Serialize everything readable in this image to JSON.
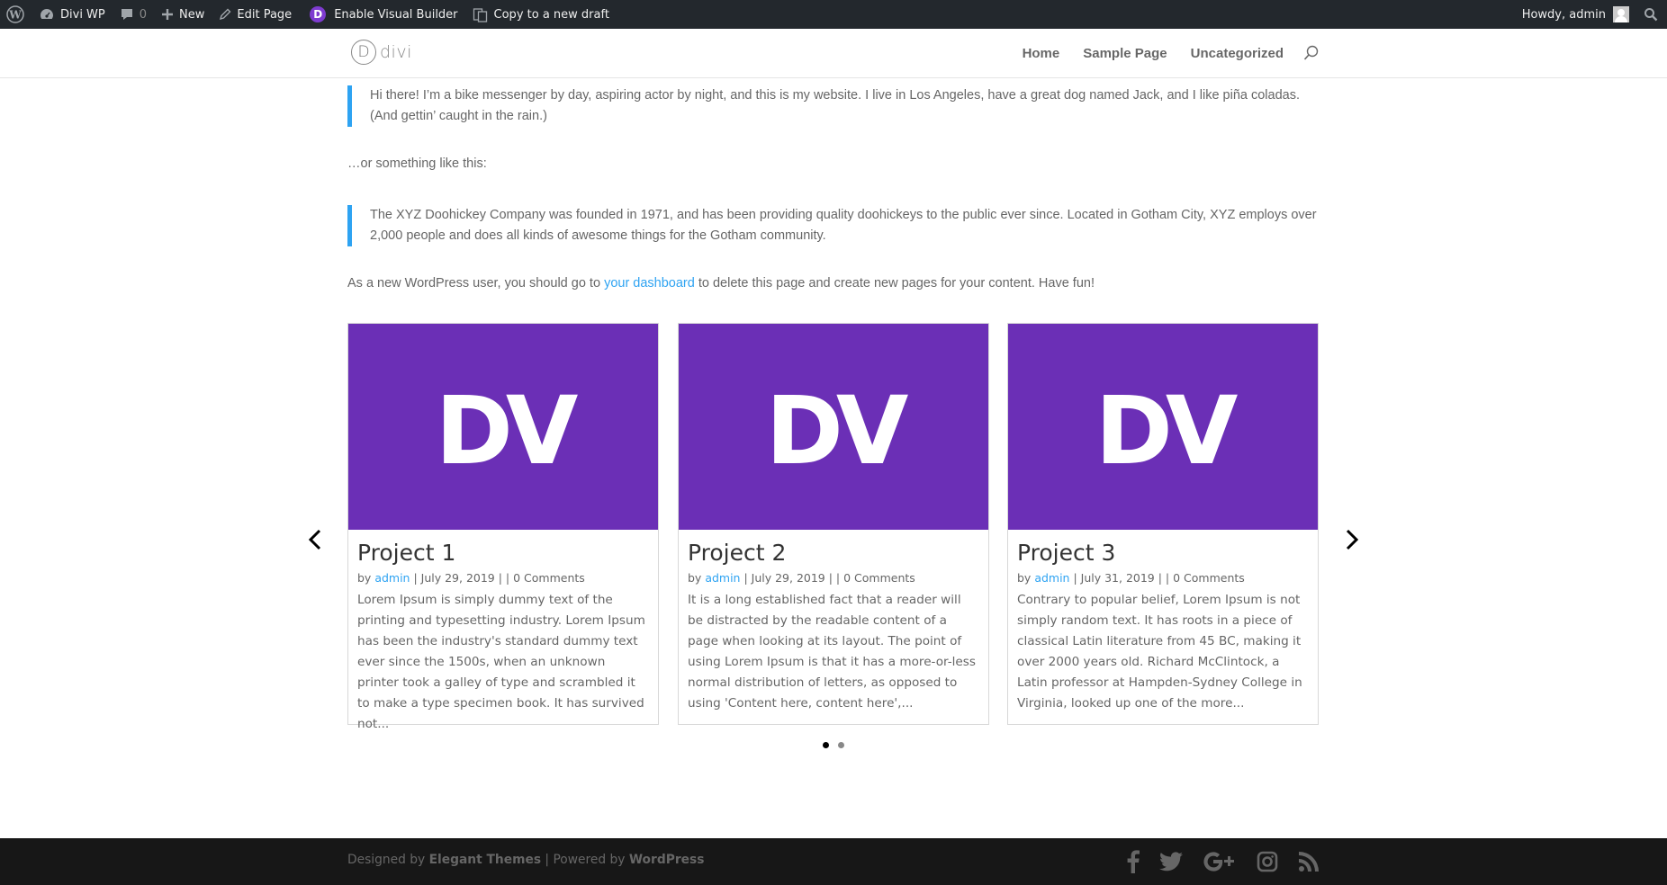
{
  "admin_bar": {
    "site_name": "Divi WP",
    "comments_count": "0",
    "new_label": "New",
    "edit_label": "Edit Page",
    "visual_builder_label": "Enable Visual Builder",
    "divi_icon_letter": "D",
    "copy_label": "Copy to a new draft",
    "howdy": "Howdy, admin"
  },
  "header": {
    "logo_letter": "D",
    "logo_text": "divi",
    "nav": [
      "Home",
      "Sample Page",
      "Uncategorized"
    ]
  },
  "content": {
    "quote1": "Hi there! I’m a bike messenger by day, aspiring actor by night, and this is my website. I live in Los Angeles, have a great dog named Jack, and I like piña coladas. (And gettin’ caught in the rain.)",
    "middle": "…or something like this:",
    "quote2": "The XYZ Doohickey Company was founded in 1971, and has been providing quality doohickeys to the public ever since. Located in Gotham City, XYZ employs over 2,000 people and does all kinds of awesome things for the Gotham community.",
    "final_before": "As a new WordPress user, you should go to ",
    "final_link": "your dashboard",
    "final_after": " to delete this page and create new pages for your content. Have fun!"
  },
  "carousel": {
    "image_text": "DV",
    "image_color": "#6b2fb6",
    "accent_color": "#2ea3f2",
    "cards": [
      {
        "title": "Project 1",
        "by": "by ",
        "author": "admin",
        "date": " | July 29, 2019 | | 0 Comments",
        "excerpt": "Lorem Ipsum is simply dummy text of the printing and typesetting industry. Lorem Ipsum has been the industry's standard dummy text ever since the 1500s, when an unknown printer took a galley of type and scrambled it to make a type specimen book. It has survived not..."
      },
      {
        "title": "Project 2",
        "by": "by ",
        "author": "admin",
        "date": " | July 29, 2019 | | 0 Comments",
        "excerpt": "It is a long established fact that a reader will be distracted by the readable content of a page when looking at its layout. The point of using Lorem Ipsum is that it has a more-or-less normal distribution of letters, as opposed to using 'Content here, content here',..."
      },
      {
        "title": "Project 3",
        "by": "by ",
        "author": "admin",
        "date": " | July 31, 2019 | | 0 Comments",
        "excerpt": "Contrary to popular belief, Lorem Ipsum is not simply random text. It has roots in a piece of classical Latin literature from 45 BC, making it over 2000 years old. Richard McClintock, a Latin professor at Hampden-Sydney College in Virginia, looked up one of the more..."
      }
    ],
    "pages": 2,
    "active_page": 1
  },
  "footer": {
    "designed_by": "Designed by ",
    "elegant": "Elegant Themes",
    "sep": " | Powered by ",
    "wordpress": "WordPress",
    "social": [
      "facebook-icon",
      "twitter-icon",
      "google-plus-icon",
      "instagram-icon",
      "rss-icon"
    ]
  }
}
